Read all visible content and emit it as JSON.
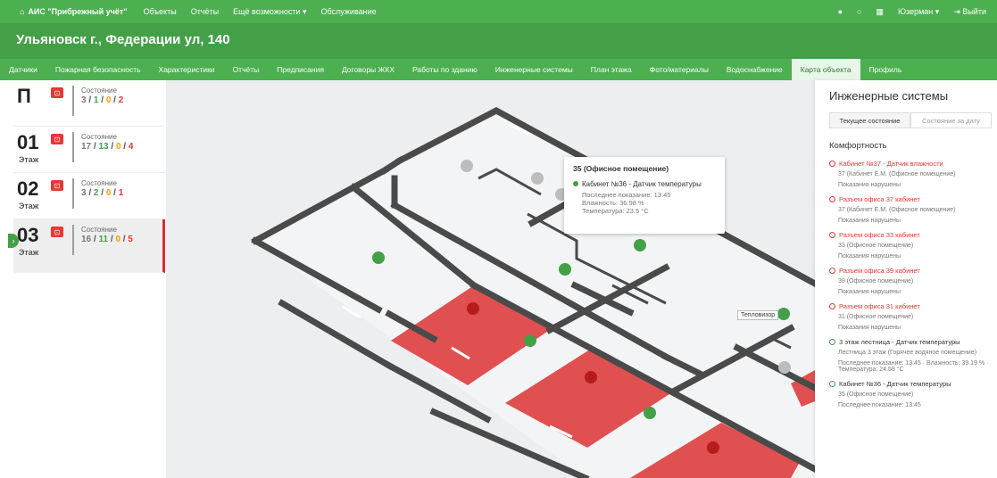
{
  "topnav": {
    "brand": "АИС \"Прибрежный учёт\"",
    "menu": [
      "Объекты",
      "Отчёты",
      "Ещё возможности ▾",
      "Обслуживание"
    ],
    "user": "Юзерман ▾",
    "logout": "⇥ Выйти"
  },
  "address": "Ульяновск г., Федерации ул, 140",
  "tabs": [
    "Датчики",
    "Пожарная безопасность",
    "Характеристики",
    "Отчёты",
    "Предписания",
    "Договоры ЖКХ",
    "Работы по зданию",
    "Инженерные системы",
    "План этажа",
    "Фото/материалы",
    "Водоснабжение",
    "Карта объекта",
    "Профиль"
  ],
  "active_tab": "Карта объекта",
  "floors": [
    {
      "num": "П",
      "sub": "",
      "label": "Состояние",
      "c": [
        "3",
        "1",
        "0",
        "2"
      ]
    },
    {
      "num": "01",
      "sub": "Этаж",
      "label": "Состояние",
      "c": [
        "17",
        "13",
        "0",
        "4"
      ]
    },
    {
      "num": "02",
      "sub": "Этаж",
      "label": "Состояние",
      "c": [
        "3",
        "2",
        "0",
        "1"
      ]
    },
    {
      "num": "03",
      "sub": "Этаж",
      "label": "Состояние",
      "c": [
        "16",
        "11",
        "0",
        "5"
      ]
    }
  ],
  "popup": {
    "title": "35 (Офисное помещение)",
    "item": "Кабинет №36 - Датчик температуры",
    "details": [
      "Последнее показание: 13:45",
      "Влажность: 36.98 %",
      "Температура: 23.5 °C"
    ]
  },
  "tooltip": "Тепловизор",
  "panel": {
    "title": "Инженерные системы",
    "seg": [
      "Текущее состояние",
      "Состояние за дату"
    ],
    "group": "Комфортность",
    "alerts": [
      {
        "t": "Кабинет №37 - Датчик влажности",
        "d": "37 (Кабинет Е.М. (Офисное помещение)",
        "s": "Показания нарушены",
        "ok": false
      },
      {
        "t": "Разъем офиса 37 кабинет",
        "d": "37 (Кабинет Е.М. (Офисное помещение)",
        "s": "Показания нарушены",
        "ok": false
      },
      {
        "t": "Разъем офиса 33 кабинет",
        "d": "33 (Офисное помещение)",
        "s": "Показания нарушены",
        "ok": false
      },
      {
        "t": "Разъем офиса 39 кабинет",
        "d": "39 (Офисное помещение)",
        "s": "Показания нарушены",
        "ok": false
      },
      {
        "t": "Разъем офиса 31 кабинет",
        "d": "31 (Офисное помещение)",
        "s": "Показания нарушены",
        "ok": false
      },
      {
        "t": "3 этаж лестница - Датчик температуры",
        "d": "Лестница 3 этаж (Горячее водяное помещение)",
        "s": "Последнее показание: 13:45 · Влажность: 39.19 % · Температура: 24.58 °C",
        "ok": true
      },
      {
        "t": "Кабинет №36 - Датчик температуры",
        "d": "35 (Офисное помещение)",
        "s": "Последнее показание: 13:45",
        "ok": true
      }
    ]
  },
  "colors": {
    "green": "#4caf50",
    "red": "#e53935",
    "alarm_room": "#e05050"
  }
}
